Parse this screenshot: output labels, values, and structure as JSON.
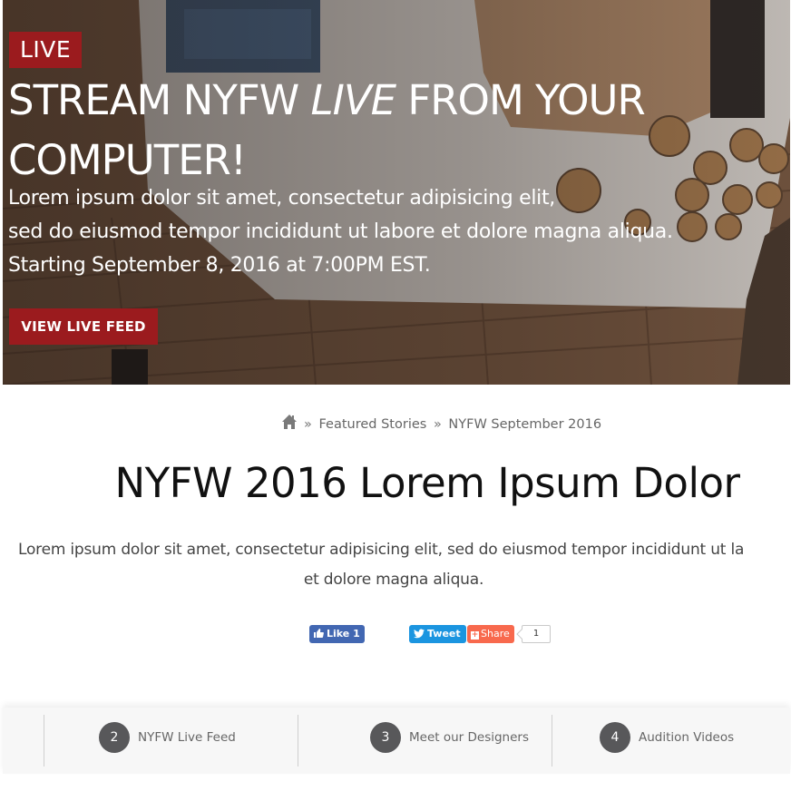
{
  "hero": {
    "badge": "LIVE",
    "title_part1": "STREAM NYFW ",
    "title_emphasis": "LIVE",
    "title_part2": " FROM YOUR COMPUTER!",
    "description_lines": [
      "Lorem ipsum dolor sit amet, consectetur adipisicing elit,",
      "sed do eiusmod tempor incididunt ut labore et dolore magna aliqua.",
      "Starting September 8, 2016 at 7:00PM EST."
    ],
    "cta_label": "VIEW LIVE FEED",
    "accent_color": "#9b1b1e"
  },
  "breadcrumb": {
    "separator": "»",
    "items": [
      "Featured Stories",
      "NYFW September 2016"
    ]
  },
  "article": {
    "title": "NYFW 2016 Lorem Ipsum Dolor",
    "lead_line1": "Lorem ipsum dolor sit amet, consectetur adipisicing elit, sed do eiusmod tempor incididunt ut la",
    "lead_line2": "et dolore magna aliqua."
  },
  "social": {
    "like_label": "Like 1",
    "tweet_label": "Tweet",
    "share_label": "Share",
    "share_count": "1",
    "facebook_color": "#4267b2",
    "twitter_color": "#1b95e0",
    "share_color": "#f8694d"
  },
  "bottom_nav": {
    "items": [
      {
        "number": "2",
        "label": "NYFW Live Feed"
      },
      {
        "number": "3",
        "label": "Meet our Designers"
      },
      {
        "number": "4",
        "label": "Audition Videos"
      }
    ]
  }
}
